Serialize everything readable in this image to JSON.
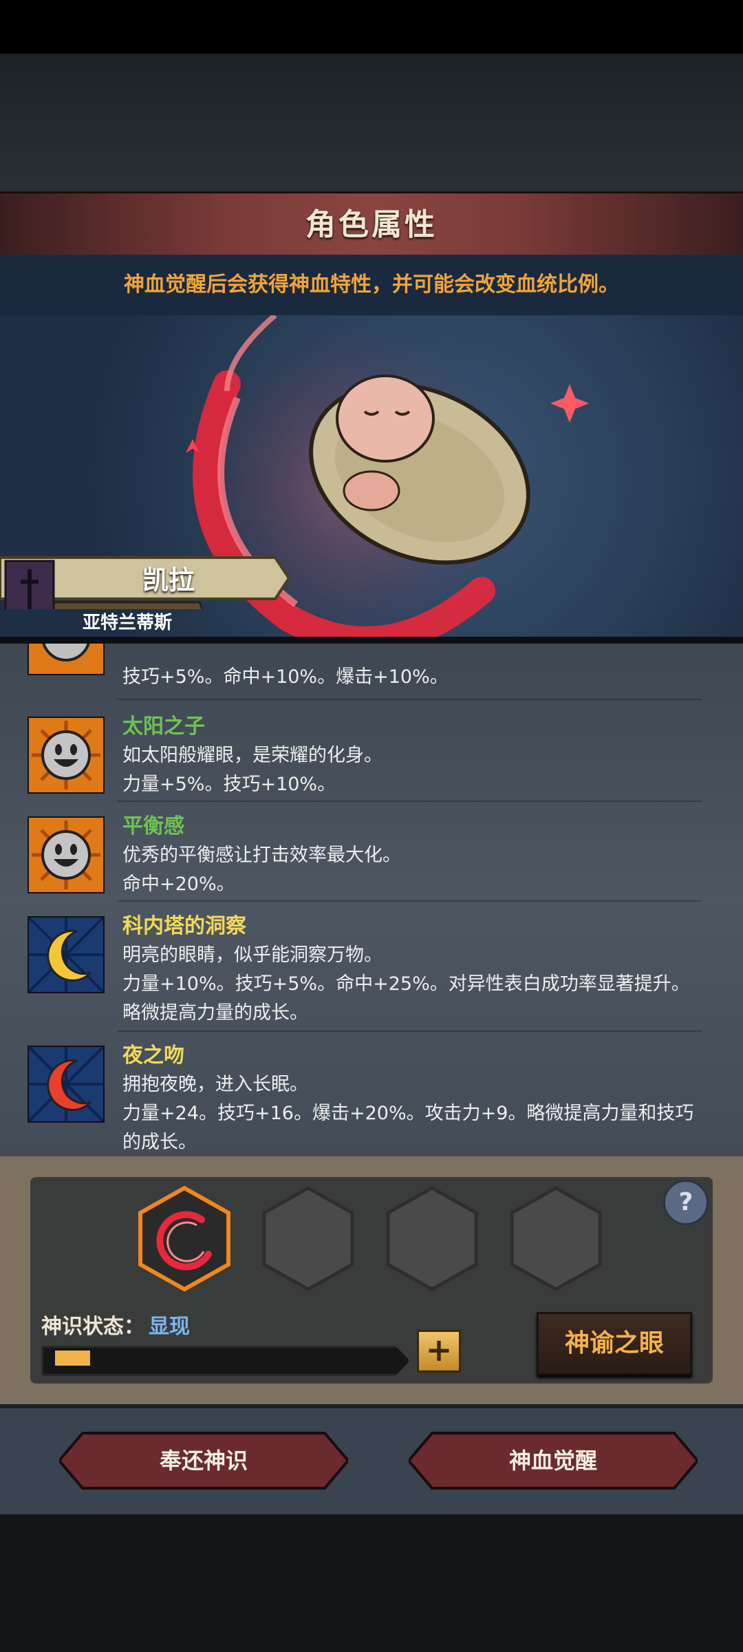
{
  "header": {
    "title": "角色属性"
  },
  "notice": "神血觉醒后会获得神血特性，并可能会改变血统比例。",
  "character": {
    "name": "凯拉",
    "lineage": "亚特兰蒂斯"
  },
  "traits": [
    {
      "name": "",
      "name_color": "#6fc352",
      "lines": [
        "技巧+5%。命中+10%。爆击+10%。"
      ],
      "icon": "smiley-sun-icon"
    },
    {
      "name": "太阳之子",
      "name_color": "#6fc352",
      "lines": [
        "如太阳般耀眼，是荣耀的化身。",
        "力量+5%。技巧+10%。"
      ],
      "icon": "smiley-sun-icon"
    },
    {
      "name": "平衡感",
      "name_color": "#6fc352",
      "lines": [
        "优秀的平衡感让打击效率最大化。",
        "命中+20%。"
      ],
      "icon": "smiley-sun-icon"
    },
    {
      "name": "科内塔的洞察",
      "name_color": "#f3d95a",
      "lines": [
        "明亮的眼睛，似乎能洞察万物。",
        "力量+10%。技巧+5%。命中+25%。对异性表白成功率显著提升。",
        "略微提高力量的成长。"
      ],
      "icon": "golden-crescent-icon"
    },
    {
      "name": "夜之吻",
      "name_color": "#f3d95a",
      "lines": [
        "拥抱夜晚，进入长眠。",
        "力量+24。技巧+16。爆击+20%。攻击力+9。略微提高力量和技巧",
        "的成长。"
      ],
      "icon": "red-crescent-icon"
    }
  ],
  "divine": {
    "state_label": "神识状态：",
    "state_value": "显现",
    "progress": 0.1,
    "help": "?",
    "plus": "+",
    "oracle_button": "神谕之眼"
  },
  "footer": {
    "return_button": "奉还神识",
    "awaken_button": "神血觉醒"
  }
}
